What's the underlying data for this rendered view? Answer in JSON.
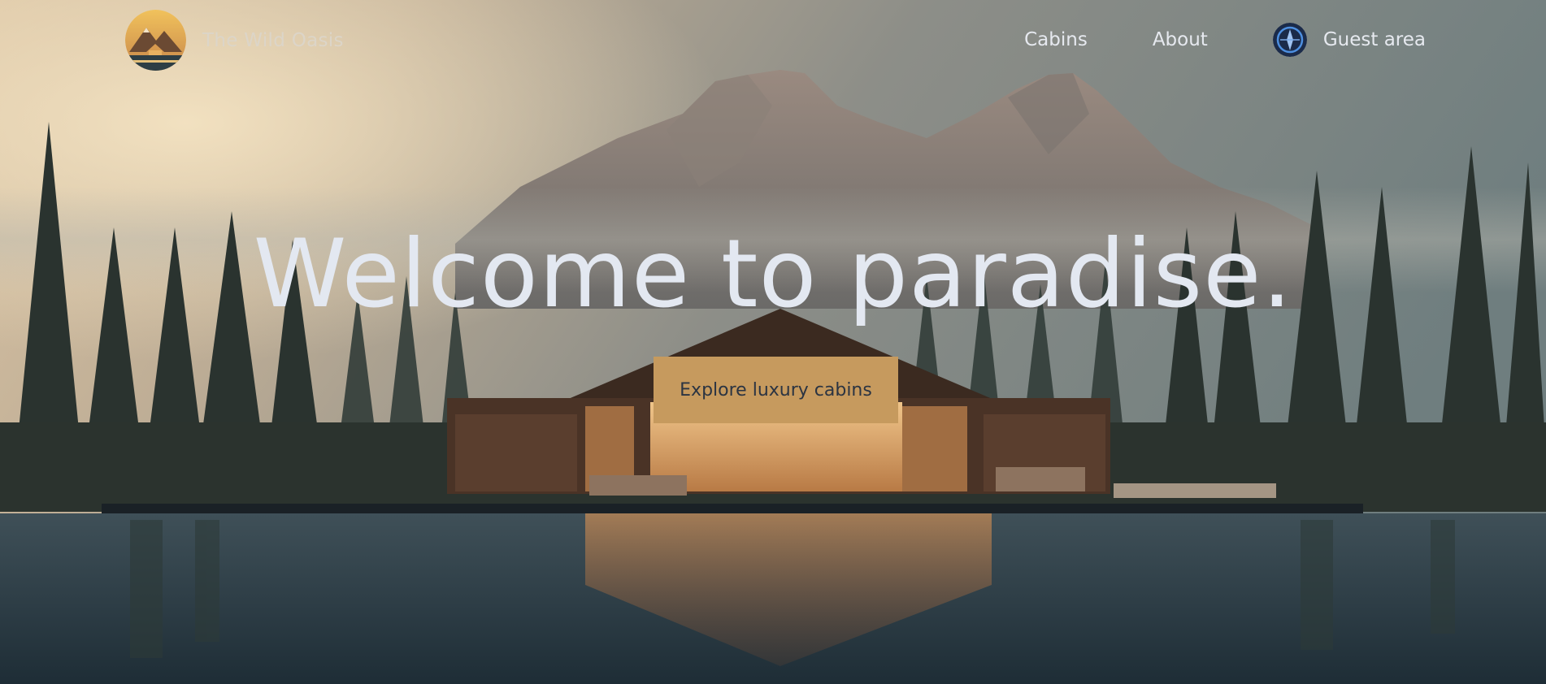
{
  "header": {
    "brand_name": "The Wild Oasis",
    "nav": [
      {
        "label": "Cabins"
      },
      {
        "label": "About"
      },
      {
        "label": "Guest area"
      }
    ]
  },
  "hero": {
    "title": "Welcome to paradise.",
    "cta_label": "Explore luxury cabins"
  },
  "colors": {
    "cta_background": "#c69a5e",
    "cta_text": "#2b3442",
    "hero_text": "#e3e8f1"
  },
  "icons": {
    "logo": "mountain-cabin-logo",
    "guest_avatar": "user-avatar-icon"
  }
}
